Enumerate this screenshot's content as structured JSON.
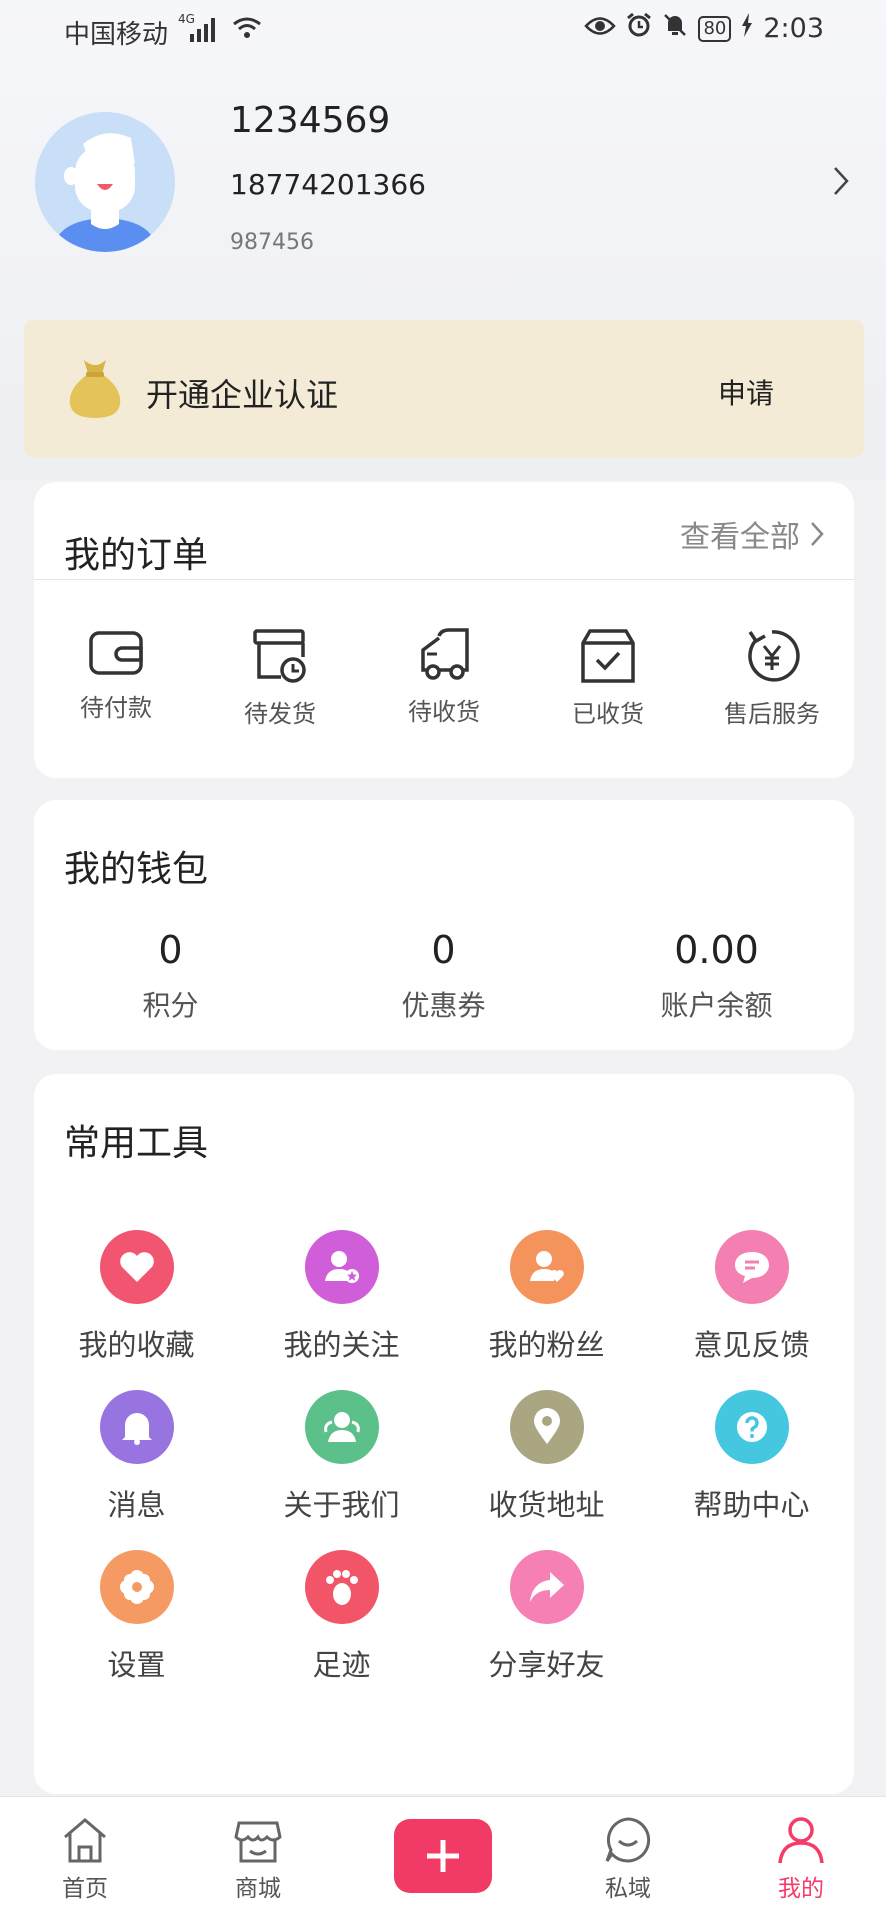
{
  "status_bar": {
    "carrier": "中国移动",
    "network": "4G",
    "battery": "80",
    "time": "2:03"
  },
  "profile": {
    "username": "1234569",
    "phone": "18774201366",
    "id": "987456"
  },
  "banner": {
    "title": "开通企业认证",
    "action": "申请"
  },
  "orders": {
    "title": "我的订单",
    "view_all": "查看全部",
    "items": [
      {
        "label": "待付款",
        "icon": "wallet-icon"
      },
      {
        "label": "待发货",
        "icon": "box-clock-icon"
      },
      {
        "label": "待收货",
        "icon": "truck-icon"
      },
      {
        "label": "已收货",
        "icon": "box-check-icon"
      },
      {
        "label": "售后服务",
        "icon": "yen-refresh-icon"
      }
    ]
  },
  "wallet": {
    "title": "我的钱包",
    "items": [
      {
        "value": "0",
        "label": "积分"
      },
      {
        "value": "0",
        "label": "优惠券"
      },
      {
        "value": "0.00",
        "label": "账户余额"
      }
    ]
  },
  "tools": {
    "title": "常用工具",
    "items": [
      {
        "label": "我的收藏",
        "icon": "heart-icon",
        "color": "#f2556f"
      },
      {
        "label": "我的关注",
        "icon": "user-star-icon",
        "color": "#d05ed8"
      },
      {
        "label": "我的粉丝",
        "icon": "user-heart-icon",
        "color": "#f5935c"
      },
      {
        "label": "意见反馈",
        "icon": "chat-bubble-icon",
        "color": "#f47fb1"
      },
      {
        "label": "消息",
        "icon": "bell-icon",
        "color": "#9874e0"
      },
      {
        "label": "关于我们",
        "icon": "people-icon",
        "color": "#5cc08b"
      },
      {
        "label": "收货地址",
        "icon": "location-pin-icon",
        "color": "#aaa682"
      },
      {
        "label": "帮助中心",
        "icon": "question-icon",
        "color": "#45c7e0"
      },
      {
        "label": "设置",
        "icon": "flower-gear-icon",
        "color": "#f59a63"
      },
      {
        "label": "足迹",
        "icon": "footprint-icon",
        "color": "#f25468"
      },
      {
        "label": "分享好友",
        "icon": "share-arrow-icon",
        "color": "#f67fb4"
      }
    ]
  },
  "tabbar": {
    "items": [
      {
        "label": "首页",
        "icon": "home-icon"
      },
      {
        "label": "商城",
        "icon": "store-icon"
      },
      {
        "label": "",
        "icon": "plus-icon"
      },
      {
        "label": "私域",
        "icon": "smile-bubble-icon"
      },
      {
        "label": "我的",
        "icon": "person-icon"
      }
    ],
    "active_color": "#f33c6a"
  }
}
